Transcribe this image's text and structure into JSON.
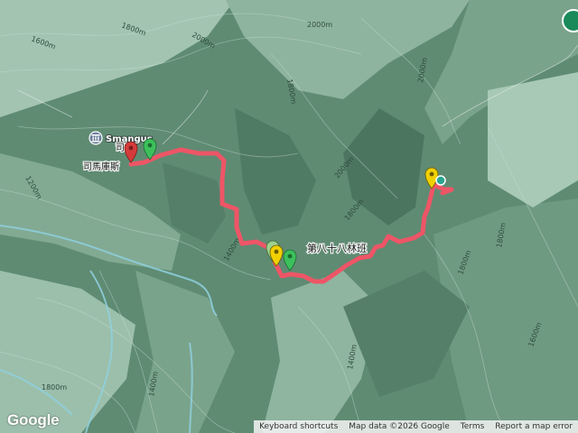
{
  "colors": {
    "route": "#ee5566",
    "terrain_dark": "#4f7a63",
    "terrain_light": "#a9cdb8",
    "river": "#7ec8d8",
    "marker_start": "#d63b3b",
    "marker_green": "#3cc05c",
    "marker_yellow": "#f0d000"
  },
  "places": {
    "village_en": "Smangus",
    "village_zh": "司馬庫斯",
    "village_zh_partial": "司馬",
    "forest_section": "第八十八林班"
  },
  "contour_labels": [
    "1600m",
    "1800m",
    "2000m",
    "2000m",
    "1800m",
    "2000m",
    "1800m",
    "1200m",
    "1400m",
    "1800m",
    "1800m",
    "1400m",
    "1800m",
    "1400m",
    "1600m",
    "2000m"
  ],
  "footer": {
    "shortcuts": "Keyboard shortcuts",
    "map_data": "Map data ©2026 Google",
    "terms": "Terms",
    "report": "Report a map error"
  },
  "logo": "Google",
  "icons": {
    "village": "museum-icon",
    "start": "red-pin-icon",
    "waypoint": "green-pin-icon",
    "rest": "yellow-pin-icon"
  }
}
